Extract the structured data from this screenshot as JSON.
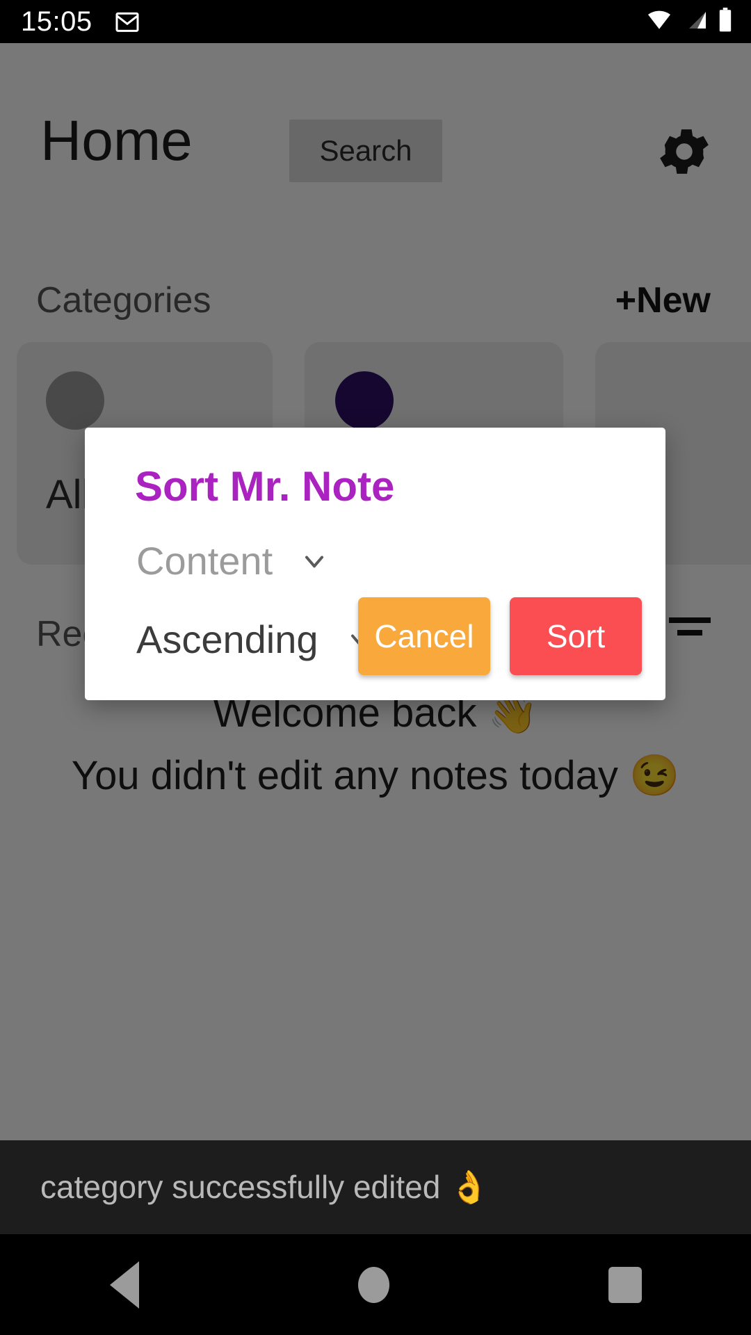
{
  "statusbar": {
    "time": "15:05",
    "icons": [
      "gmail-icon",
      "wifi-icon",
      "cellular-signal-icon",
      "battery-icon"
    ]
  },
  "app": {
    "header": {
      "title": "Home",
      "search_label": "Search",
      "settings_icon": "gear-icon"
    },
    "categories": {
      "label": "Categories",
      "new_label": "+New",
      "cards": [
        {
          "name": "All",
          "avatar_color": "#9a9a9a"
        },
        {
          "name": "",
          "avatar_color": "#2e1065"
        },
        {
          "name": "",
          "avatar_color": "#8a8a8a"
        }
      ]
    },
    "recent": {
      "label": "Recent",
      "sort_icon": "sort-icon"
    },
    "empty_state": {
      "line1": "Welcome back 👋",
      "line2": "You didn't edit any notes today 😉"
    }
  },
  "snackbar": {
    "message": "category successfully edited 👌"
  },
  "dialog": {
    "title": "Sort Mr. Note",
    "title_color": "#AA22C0",
    "field_sort_by": {
      "value": "Content",
      "chevron_icon": "chevron-down-icon"
    },
    "field_order": {
      "value": "Ascending",
      "chevron_icon": "chevron-down-icon"
    },
    "cancel_label": "Cancel",
    "sort_label": "Sort",
    "cancel_color": "#F9A93C",
    "sort_color": "#FA4E53"
  },
  "navbar": {
    "back": "back-icon",
    "home": "home-icon",
    "recents": "recents-icon"
  }
}
